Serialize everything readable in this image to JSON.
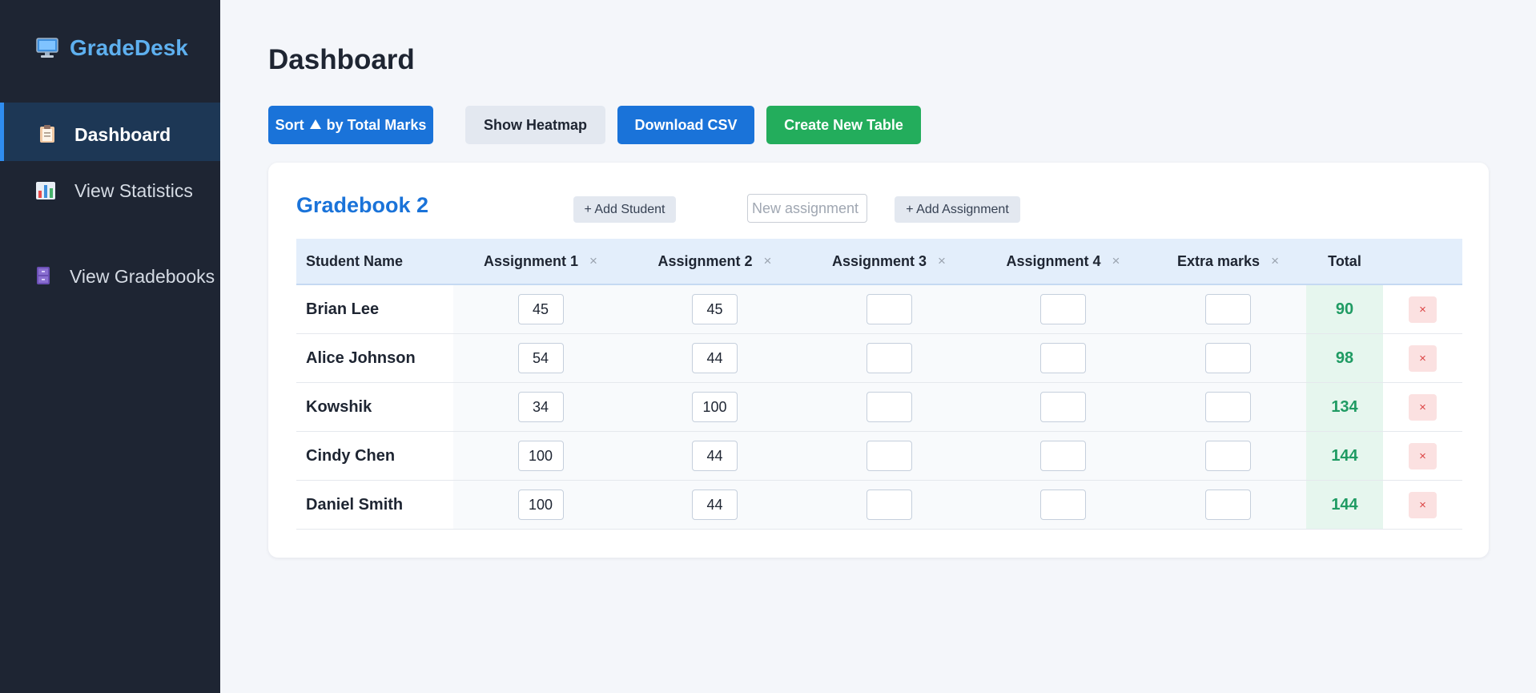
{
  "app": {
    "name": "GradeDesk",
    "logo_icon": "monitor-icon",
    "accent_color": "#1a73d9"
  },
  "sidebar": {
    "items": [
      {
        "label": "Dashboard",
        "icon": "clipboard-icon",
        "active": true
      },
      {
        "label": "View Statistics",
        "icon": "bar-chart-icon",
        "active": false
      },
      {
        "label": "View Gradebooks",
        "icon": "filing-cabinet-icon",
        "active": false
      }
    ]
  },
  "page": {
    "title": "Dashboard"
  },
  "toolbar": {
    "sort_prefix": "Sort",
    "sort_suffix": "by Total Marks",
    "sort_icon": "triangle-up-icon",
    "heatmap_label": "Show Heatmap",
    "csv_label": "Download CSV",
    "new_table_label": "Create New Table"
  },
  "gradebook": {
    "title": "Gradebook 2",
    "add_student_label": "+ Add Student",
    "new_assignment_placeholder": "New assignment",
    "new_assignment_value": "",
    "add_assignment_label": "+ Add Assignment",
    "remove_column_glyph": "×",
    "delete_row_glyph": "×",
    "headers": {
      "name": "Student Name",
      "columns": [
        "Assignment 1",
        "Assignment 2",
        "Assignment 3",
        "Assignment 4",
        "Extra marks"
      ],
      "total": "Total"
    },
    "rows": [
      {
        "name": "Brian Lee",
        "marks": [
          "45",
          "45",
          "",
          "",
          ""
        ],
        "total": "90"
      },
      {
        "name": "Alice Johnson",
        "marks": [
          "54",
          "44",
          "",
          "",
          ""
        ],
        "total": "98"
      },
      {
        "name": "Kowshik",
        "marks": [
          "34",
          "100",
          "",
          "",
          ""
        ],
        "total": "134"
      },
      {
        "name": "Cindy Chen",
        "marks": [
          "100",
          "44",
          "",
          "",
          ""
        ],
        "total": "144"
      },
      {
        "name": "Daniel Smith",
        "marks": [
          "100",
          "44",
          "",
          "",
          ""
        ],
        "total": "144"
      }
    ]
  }
}
